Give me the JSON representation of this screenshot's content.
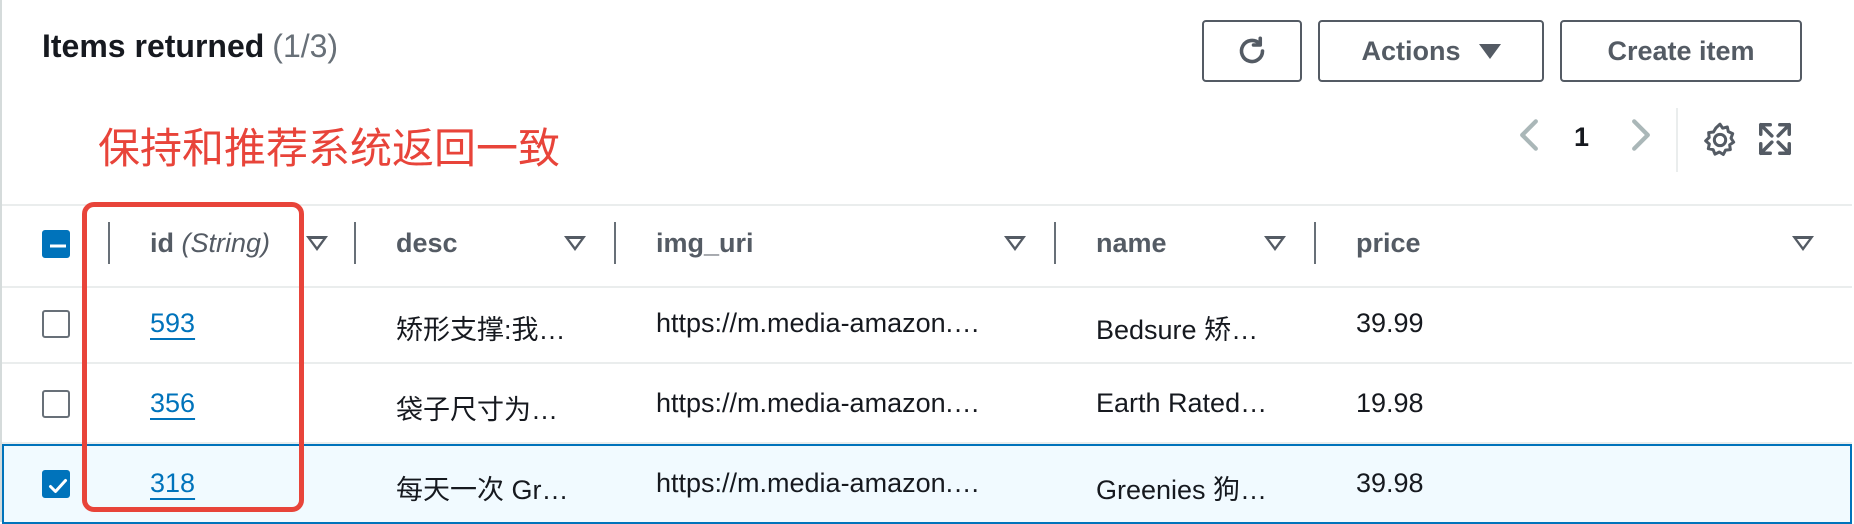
{
  "header": {
    "title": "Items returned",
    "count": "(1/3)",
    "buttons": {
      "refresh_icon": "refresh-icon",
      "actions_label": "Actions",
      "create_label": "Create item"
    }
  },
  "annotation": {
    "text": "保持和推荐系统返回一致",
    "color": "#e8443a"
  },
  "pagination": {
    "current_page": "1",
    "prev_icon": "chevron-left-icon",
    "next_icon": "chevron-right-icon"
  },
  "tools": {
    "settings_icon": "gear-icon",
    "fullscreen_icon": "expand-icon"
  },
  "table": {
    "columns": [
      {
        "label": "id",
        "type_label": "(String)"
      },
      {
        "label": "desc"
      },
      {
        "label": "img_uri"
      },
      {
        "label": "name"
      },
      {
        "label": "price"
      }
    ],
    "rows": [
      {
        "selected": false,
        "id": "593",
        "desc": "矫形支撑:我…",
        "img_uri": "https://m.media-amazon.…",
        "name": "Bedsure 矫…",
        "price": "39.99"
      },
      {
        "selected": false,
        "id": "356",
        "desc": "袋子尺寸为…",
        "img_uri": "https://m.media-amazon.…",
        "name": "Earth Rated…",
        "price": "19.98"
      },
      {
        "selected": true,
        "id": "318",
        "desc": "每天一次 Gr…",
        "img_uri": "https://m.media-amazon.…",
        "name": "Greenies 狗…",
        "price": "39.98"
      }
    ]
  },
  "colors": {
    "accent": "#0073bb",
    "annotation": "#e8443a",
    "selected_row_bg": "#f1faff"
  }
}
